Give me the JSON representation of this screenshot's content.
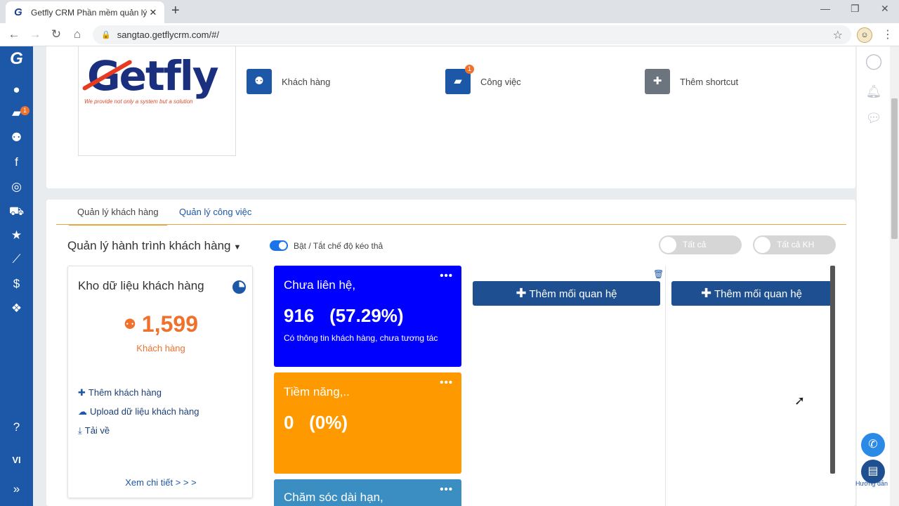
{
  "browser": {
    "tab_title": "Getfly CRM Phần mềm quản lý và",
    "url": "sangtao.getflycrm.com/#/"
  },
  "sidebar": {
    "task_badge": "1",
    "lang": "VI"
  },
  "logo": {
    "word": "Getfly",
    "tagline": "We provide not only a system but a solution"
  },
  "shortcuts": [
    {
      "label": "Khách hàng",
      "color": "#1d57a8",
      "icon": "users-icon"
    },
    {
      "label": "Công việc",
      "color": "#1d57a8",
      "icon": "briefcase-icon",
      "badge": "1"
    },
    {
      "label": "Thêm shortcut",
      "color": "#6c757d",
      "icon": "plus-icon"
    }
  ],
  "tabs": {
    "customers": "Quản lý khách hàng",
    "tasks": "Quản lý công việc"
  },
  "journey": {
    "title": "Quản lý hành trình khách hàng",
    "toggle_label": "Bật / Tắt chế độ kéo thả",
    "filter_all": "Tất cả",
    "filter_all_kh": "Tất cả KH"
  },
  "kho": {
    "title": "Kho dữ liệu khách hàng",
    "count": "1,599",
    "unit": "Khách hàng",
    "add": "Thêm khách hàng",
    "upload": "Upload dữ liệu khách hàng",
    "download": "Tải về",
    "more": "Xem chi tiết > > >"
  },
  "stages": [
    {
      "title": "Chưa liên hệ,",
      "value": "916",
      "percent": "(57.29%)",
      "desc": "Có thông tin khách hàng, chưa tương tác",
      "color": "#0000ff"
    },
    {
      "title": "Tiềm năng,..",
      "value": "0",
      "percent": "(0%)",
      "color": "#ff9900"
    },
    {
      "title": "Chăm sóc dài hạn,",
      "color": "#3b8ec2"
    }
  ],
  "add_relation": "Thêm mối quan hệ",
  "help_label": "Hướng dẫn",
  "colors": {
    "brand": "#1d57a8",
    "accent": "#f0712c"
  }
}
